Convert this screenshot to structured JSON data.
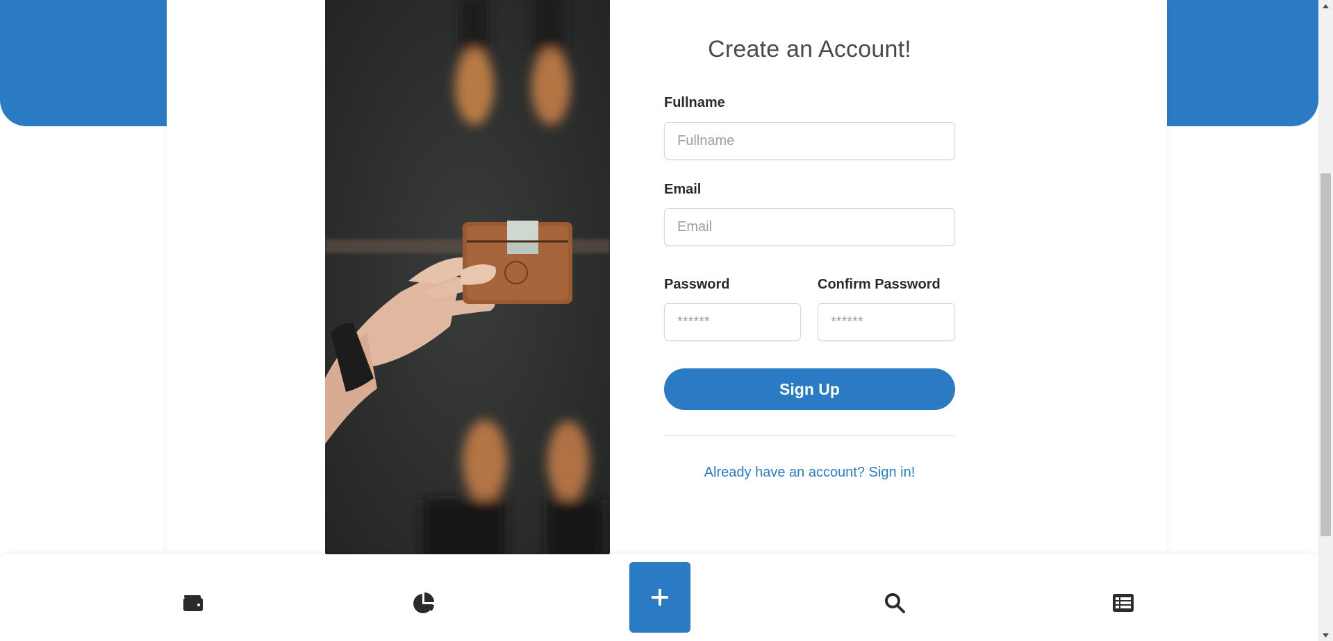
{
  "form": {
    "title": "Create an Account!",
    "fullname_label": "Fullname",
    "fullname_placeholder": "Fullname",
    "email_label": "Email",
    "email_placeholder": "Email",
    "password_label": "Password",
    "password_placeholder": "******",
    "confirm_label": "Confirm Password",
    "confirm_placeholder": "******",
    "submit_label": "Sign Up",
    "signin_link": "Already have an account? Sign in!"
  },
  "bottom_nav": {
    "items": [
      {
        "icon": "wallet-icon"
      },
      {
        "icon": "pie-chart-icon"
      },
      {
        "icon": "plus-icon"
      },
      {
        "icon": "search-icon"
      },
      {
        "icon": "list-icon"
      }
    ]
  },
  "colors": {
    "brand": "#2a7bc4",
    "text_dark": "#2a2a2a",
    "title": "#4a4a4a"
  }
}
